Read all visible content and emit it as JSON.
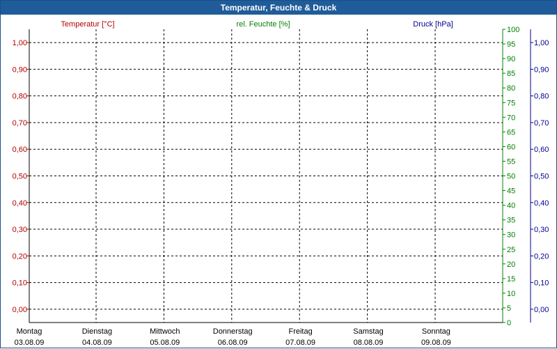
{
  "window": {
    "title": "Temperatur, Feuchte & Druck"
  },
  "colors": {
    "temperature": "#b00000",
    "humidity": "#008000",
    "pressure": "#00008b",
    "titlebar": "#1f5c99"
  },
  "chart_data": {
    "type": "line",
    "title": "Temperatur, Feuchte & Druck",
    "grid": true,
    "x": {
      "categories": [
        {
          "day": "Montag",
          "date": "03.08.09"
        },
        {
          "day": "Dienstag",
          "date": "04.08.09"
        },
        {
          "day": "Mittwoch",
          "date": "05.08.09"
        },
        {
          "day": "Donnerstag",
          "date": "06.08.09"
        },
        {
          "day": "Freitag",
          "date": "07.08.09"
        },
        {
          "day": "Samstag",
          "date": "08.08.09"
        },
        {
          "day": "Sonntag",
          "date": "09.08.09"
        }
      ]
    },
    "axes": {
      "temperature": {
        "label": "Temperatur [°C]",
        "position": "left",
        "ylim": [
          -0.05,
          1.05
        ],
        "ticks": [
          "0,00",
          "0,10",
          "0,20",
          "0,30",
          "0,40",
          "0,50",
          "0,60",
          "0,70",
          "0,80",
          "0,90",
          "1,00"
        ]
      },
      "humidity": {
        "label": "rel. Feuchte [%]",
        "position": "right-inner",
        "ylim": [
          0,
          100
        ],
        "ticks": [
          "0",
          "5",
          "10",
          "15",
          "20",
          "25",
          "30",
          "35",
          "40",
          "45",
          "50",
          "55",
          "60",
          "65",
          "70",
          "75",
          "80",
          "85",
          "90",
          "95",
          "100"
        ]
      },
      "pressure": {
        "label": "Druck [hPa]",
        "position": "right-outer",
        "ylim": [
          -0.05,
          1.05
        ],
        "ticks": [
          "0,00",
          "0,10",
          "0,20",
          "0,30",
          "0,40",
          "0,50",
          "0,60",
          "0,70",
          "0,80",
          "0,90",
          "1,00"
        ]
      }
    },
    "series": []
  }
}
